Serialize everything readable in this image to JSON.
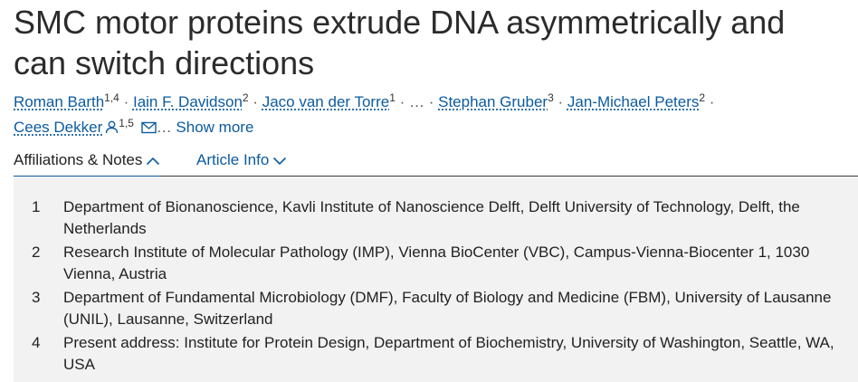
{
  "article": {
    "title": "SMC motor proteins extrude DNA asymmetrically and can switch directions"
  },
  "authors": [
    {
      "name": "Roman Barth",
      "sup": "1,4",
      "sep": " · "
    },
    {
      "name": "Iain F. Davidson",
      "sup": "2",
      "sep": " · "
    },
    {
      "name": "Jaco van der Torre",
      "sup": "1",
      "sep": " · … · "
    },
    {
      "name": "Stephan Gruber",
      "sup": "3",
      "sep": " · "
    },
    {
      "name": "Jan-Michael Peters",
      "sup": "2",
      "sep": " · "
    },
    {
      "name": "Cees Dekker",
      "sup": "1,5",
      "sep": ""
    }
  ],
  "author_list": {
    "ellipsis": "…",
    "show_more_label": "Show more",
    "person_icon": "person-icon",
    "mail_icon": "envelope-icon"
  },
  "tabs": {
    "affiliations_label": "Affiliations & Notes",
    "affiliations_icon": "chevron-up-icon",
    "article_info_label": "Article Info",
    "article_info_icon": "chevron-down-icon"
  },
  "affiliations": [
    {
      "num": "1",
      "text": "Department of Bionanoscience, Kavli Institute of Nanoscience Delft, Delft University of Technology, Delft, the Netherlands"
    },
    {
      "num": "2",
      "text": "Research Institute of Molecular Pathology (IMP), Vienna BioCenter (VBC), Campus-Vienna-Biocenter 1, 1030 Vienna, Austria"
    },
    {
      "num": "3",
      "text": "Department of Fundamental Microbiology (DMF), Faculty of Biology and Medicine (FBM), University of Lausanne (UNIL), Lausanne, Switzerland"
    },
    {
      "num": "4",
      "text": "Present address: Institute for Protein Design, Department of Biochemistry, University of Washington, Seattle, WA, USA"
    }
  ],
  "colors": {
    "link": "#0c5ba0",
    "text": "#222222",
    "panel_background": "#f2f2f2"
  }
}
